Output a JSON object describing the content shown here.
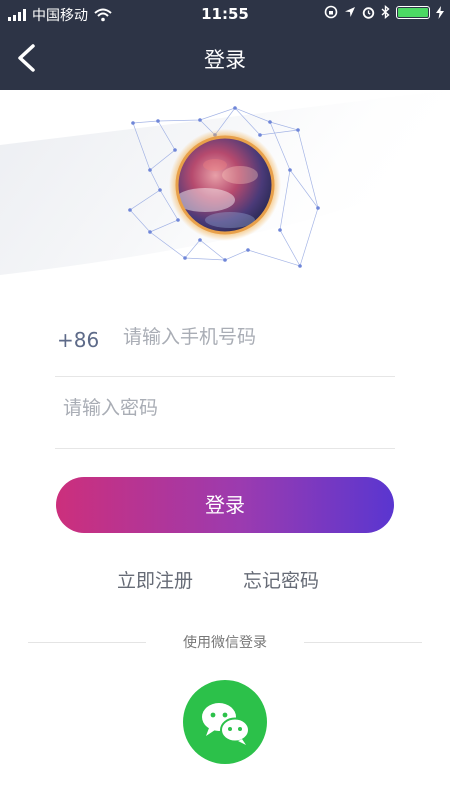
{
  "status_bar": {
    "carrier": "中国移动",
    "time": "11:55",
    "battery_level": 1.0
  },
  "nav": {
    "title": "登录",
    "back_icon": "chevron-left-icon"
  },
  "hero": {
    "avatar_icon": "nebula-avatar-icon"
  },
  "form": {
    "country_code": "+86",
    "phone_placeholder": "请输入手机号码",
    "password_placeholder": "请输入密码",
    "login_label": "登录"
  },
  "links": {
    "register": "立即注册",
    "forgot_password": "忘记密码"
  },
  "wechat": {
    "label": "使用微信登录",
    "icon": "wechat-icon"
  },
  "colors": {
    "nav_bg": "#2d3446",
    "gradient_start": "#cc2f7c",
    "gradient_end": "#5a36d0",
    "wechat_green": "#2cc14a",
    "battery_green": "#4cd964"
  }
}
